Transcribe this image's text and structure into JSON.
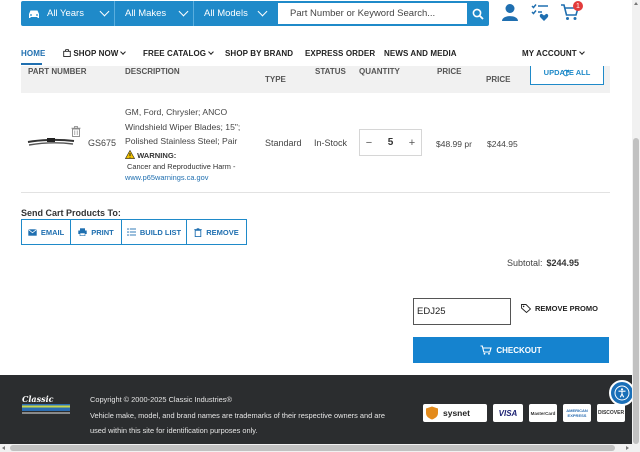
{
  "search": {
    "year_label": "All Years",
    "make_label": "All Makes",
    "model_label": "All Models",
    "keyword_placeholder": "Part Number or Keyword Search..."
  },
  "header": {
    "cart_count": "1"
  },
  "nav": {
    "home": "HOME",
    "shop_now": "SHOP NOW",
    "free_catalog": "FREE CATALOG",
    "shop_by_brand": "SHOP BY BRAND",
    "express_order": "EXPRESS ORDER",
    "news_media": "NEWS AND MEDIA",
    "my_account": "MY ACCOUNT"
  },
  "cart": {
    "columns": {
      "part_number": "PART NUMBER",
      "description": "DESCRIPTION",
      "type": "TYPE",
      "status": "STATUS",
      "quantity": "QUANTITY",
      "price": "PRICE",
      "total_price": "PRICE"
    },
    "update_all_label": "UPDATE ALL",
    "item": {
      "part_number": "GS675",
      "description": "GM, Ford, Chrysler; ANCO Windshield Wiper Blades; 15\"; Polished Stainless Steel; Pair",
      "warning_title": "WARNING:",
      "warning_text": "Cancer and Reproductive Harm -",
      "warning_link": "www.p65warnings.ca.gov",
      "type": "Standard",
      "status": "In-Stock",
      "quantity": "5",
      "unit_price": "$48.99 pr",
      "total_price": "$244.95",
      "minus_label": "−",
      "plus_label": "+"
    }
  },
  "send_cart": {
    "label": "Send Cart Products To:",
    "email": "EMAIL",
    "print": "PRINT",
    "build_list": "BUILD LIST",
    "remove": "REMOVE"
  },
  "totals": {
    "subtotal_label": "Subtotal:",
    "subtotal_value": "$244.95",
    "promo_code": "EDJ25",
    "remove_promo": "REMOVE PROMO",
    "checkout": "CHECKOUT"
  },
  "footer": {
    "copyright": "Copyright © 2000-2025 Classic Industries®",
    "note": "Vehicle make, model, and brand names are trademarks of their respective owners and are used within this site for identification purposes only.",
    "payments": [
      "sysnet",
      "VISA",
      "MasterCard",
      "AMERICAN EXPRESS",
      "DISCOVER"
    ]
  },
  "colors": {
    "brand_blue": "#1f8ac9",
    "checkout_blue": "#1583cf",
    "footer_bg": "#2b2d2f"
  }
}
